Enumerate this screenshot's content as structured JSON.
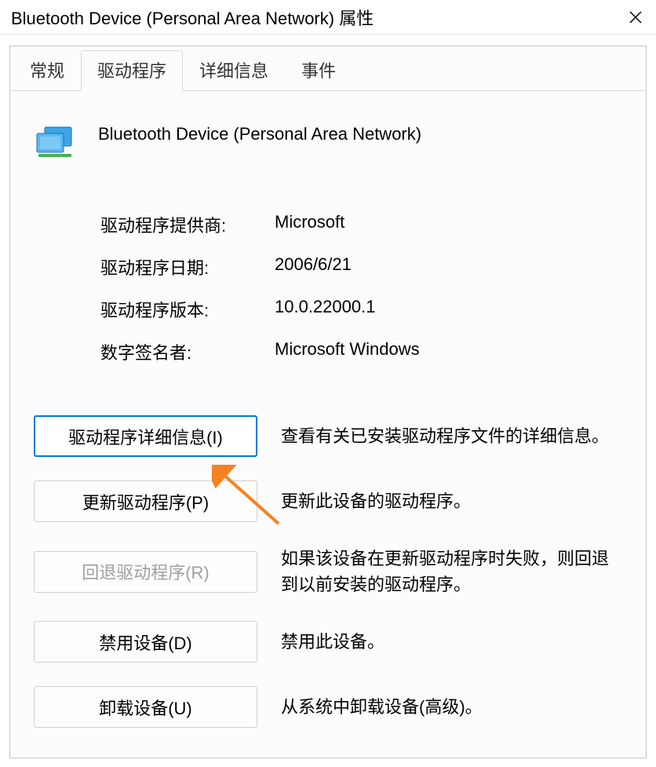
{
  "titlebar": {
    "title": "Bluetooth Device (Personal Area Network) 属性"
  },
  "tabs": {
    "general": "常规",
    "driver": "驱动程序",
    "details": "详细信息",
    "events": "事件"
  },
  "device": {
    "name": "Bluetooth Device (Personal Area Network)"
  },
  "info": {
    "provider_label": "驱动程序提供商:",
    "provider_value": "Microsoft",
    "date_label": "驱动程序日期:",
    "date_value": "2006/6/21",
    "version_label": "驱动程序版本:",
    "version_value": "10.0.22000.1",
    "signer_label": "数字签名者:",
    "signer_value": "Microsoft Windows"
  },
  "actions": {
    "details": {
      "button": "驱动程序详细信息(I)",
      "desc": "查看有关已安装驱动程序文件的详细信息。"
    },
    "update": {
      "button": "更新驱动程序(P)",
      "desc": "更新此设备的驱动程序。"
    },
    "rollback": {
      "button": "回退驱动程序(R)",
      "desc": "如果该设备在更新驱动程序时失败，则回退到以前安装的驱动程序。"
    },
    "disable": {
      "button": "禁用设备(D)",
      "desc": "禁用此设备。"
    },
    "uninstall": {
      "button": "卸载设备(U)",
      "desc": "从系统中卸载设备(高级)。"
    }
  }
}
